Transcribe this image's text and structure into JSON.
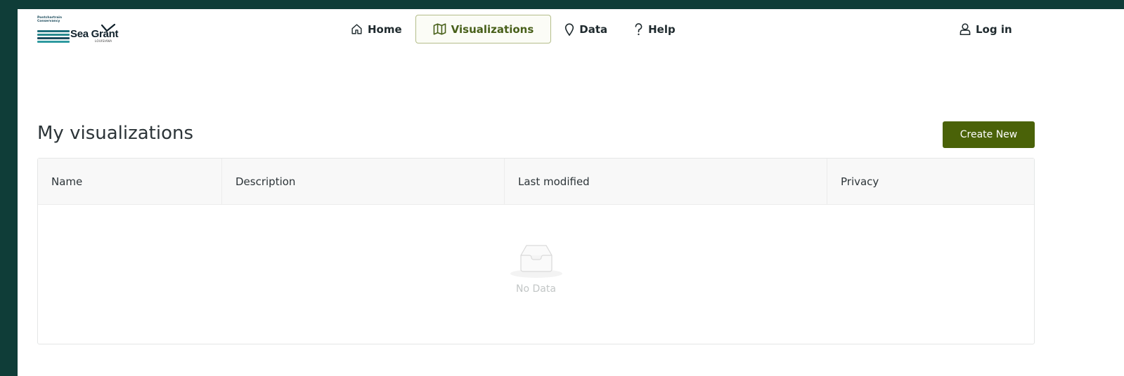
{
  "logo": {
    "small_text": [
      "Pontchartrain",
      "Conservancy"
    ],
    "main_text": "Sea Grant",
    "sub_text": "LOUISIANA",
    "stripe_colors": [
      "#1f6f7c",
      "#2a8a8f",
      "#1c4b5c",
      "#2f9aa0"
    ]
  },
  "nav": {
    "items": [
      {
        "label": "Home",
        "icon": "home-icon"
      },
      {
        "label": "Visualizations",
        "icon": "map-icon",
        "active": true
      },
      {
        "label": "Data",
        "icon": "map-pin-icon"
      },
      {
        "label": "Help",
        "icon": "question-icon"
      }
    ],
    "login_label": "Log in",
    "login_icon": "user-icon"
  },
  "page": {
    "title": "My visualizations",
    "create_label": "Create New"
  },
  "table": {
    "columns": [
      "Name",
      "Description",
      "Last modified",
      "Privacy"
    ],
    "rows": [],
    "empty_text": "No Data",
    "empty_icon": "inbox-icon"
  },
  "colors": {
    "frame": "#0f3d38",
    "accent": "#4a6208",
    "active_nav_text": "#48601a"
  }
}
